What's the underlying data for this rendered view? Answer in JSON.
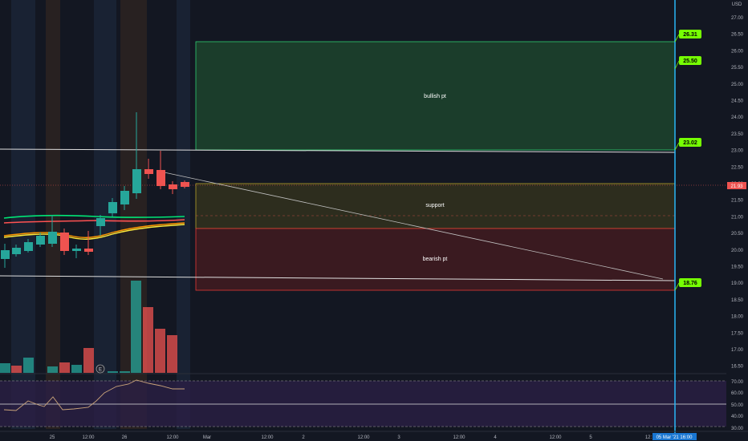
{
  "currency": "USD",
  "current_price": "21.93",
  "price_axis": [
    "27.00",
    "26.50",
    "26.00",
    "25.50",
    "25.00",
    "24.50",
    "24.00",
    "23.50",
    "23.00",
    "22.50",
    "22.00",
    "21.50",
    "21.00",
    "20.50",
    "20.00",
    "19.50",
    "19.00",
    "18.50",
    "18.00",
    "17.50",
    "17.00",
    "16.50"
  ],
  "rsi_axis": [
    "70.00",
    "60.00",
    "50.00",
    "40.00",
    "30.00"
  ],
  "time_axis": [
    "25",
    "12:00",
    "26",
    "12:00",
    "Mar",
    "12:00",
    "2",
    "12:00",
    "3",
    "12:00",
    "4",
    "12:00",
    "5",
    "12:"
  ],
  "date_badge": "05 Mar '21  16:00",
  "zones": [
    {
      "label": "bullish pt",
      "color": "#1b5e20"
    },
    {
      "label": "support",
      "color": "#827717"
    },
    {
      "label": "bearish pt",
      "color": "#7f1d1d"
    }
  ],
  "targets": [
    "26.31",
    "25.50",
    "23.02",
    "18.76"
  ],
  "colors": {
    "up": "#26a69a",
    "down": "#ef5350",
    "badge": "#76ff03",
    "vline": "#29b6f6"
  }
}
